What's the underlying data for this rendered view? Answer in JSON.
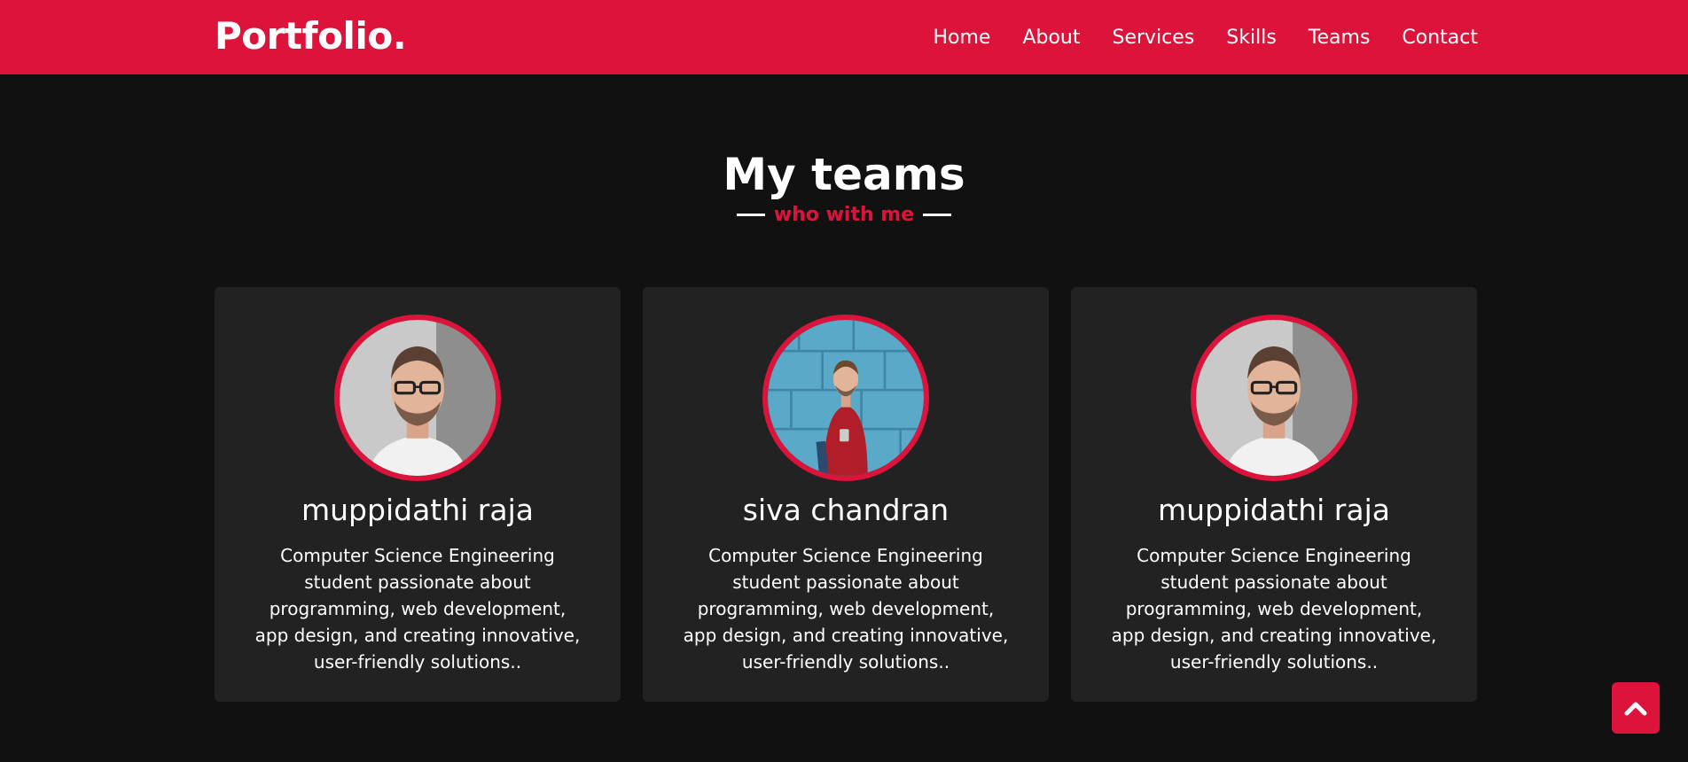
{
  "brand": "Portfolio.",
  "nav": {
    "items": [
      "Home",
      "About",
      "Services",
      "Skills",
      "Teams",
      "Contact"
    ]
  },
  "section": {
    "title": "My teams",
    "subtitle": "who with me"
  },
  "team": [
    {
      "name": "muppidathi raja",
      "description": "Computer Science Engineering student passionate about programming, web development, app design, and creating innovative, user-friendly solutions.."
    },
    {
      "name": "siva chandran",
      "description": "Computer Science Engineering student passionate about programming, web development, app design, and creating innovative, user-friendly solutions.."
    },
    {
      "name": "muppidathi raja",
      "description": "Computer Science Engineering student passionate about programming, web development, app design, and creating innovative, user-friendly solutions.."
    }
  ],
  "colors": {
    "accent": "#dc143c",
    "background": "#111111",
    "card": "#222222"
  },
  "icons": {
    "scroll_top": "chevron-up-icon"
  }
}
